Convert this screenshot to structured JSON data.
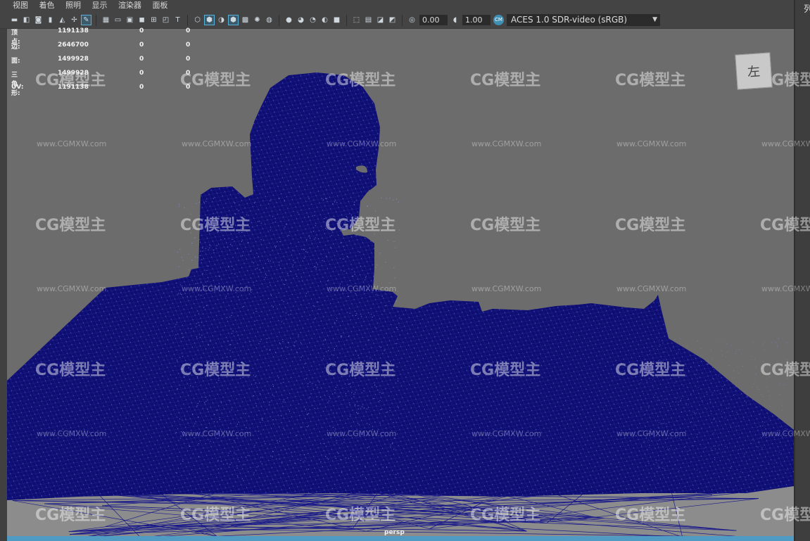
{
  "menu": [
    "视图",
    "着色",
    "照明",
    "显示",
    "渲染器",
    "面板"
  ],
  "toolbar": {
    "near_clip_value": "0.00",
    "exposure_value": "1.00",
    "color_space": "ACES 1.0 SDR-video (sRGB)",
    "color_space_badge": "CM"
  },
  "hud": {
    "rows": [
      {
        "label": "顶点:",
        "v1": "1191138",
        "v2": "0",
        "v3": "0"
      },
      {
        "label": "边:",
        "v1": "2646700",
        "v2": "0",
        "v3": "0"
      },
      {
        "label": "面:",
        "v1": "1499928",
        "v2": "0",
        "v3": "0"
      },
      {
        "label": "三角形:",
        "v1": "1499928",
        "v2": "0",
        "v3": "0"
      },
      {
        "label": "UV:",
        "v1": "1191138",
        "v2": "0",
        "v3": "0"
      }
    ]
  },
  "viewcube_label": "左",
  "camera_label": "persp",
  "right_panel_label": "列",
  "watermark": {
    "logo": "CG模型主",
    "url": "www.CGMXW.com"
  },
  "colors": {
    "mesh": "#0d0d72",
    "wire": "#8f95e0",
    "viewport_bg": "#6c6c6c",
    "ui_bg": "#444444",
    "accent": "#4f9bc4"
  }
}
